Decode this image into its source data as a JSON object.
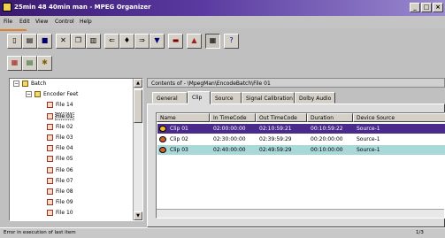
{
  "window": {
    "title": "25min 48 40min man - MPEG Organizer",
    "controls": [
      "_",
      "□",
      "×"
    ]
  },
  "menu": [
    "File",
    "Edit",
    "View",
    "Control",
    "Help"
  ],
  "toolbar_icons": [
    "new-icon",
    "open-icon",
    "save-icon",
    "cut-icon",
    "copy-icon",
    "paste-icon",
    "rewind-icon",
    "play-icon",
    "fast-forward-icon",
    "stop-icon",
    "record-icon",
    "encode-icon",
    "properties-icon",
    "help-icon"
  ],
  "toolbar2_icons": [
    "batch-icon",
    "queue-icon",
    "settings-icon"
  ],
  "tree": {
    "items": [
      {
        "label": "Batch",
        "level": 0,
        "type": "folder",
        "expander": "−"
      },
      {
        "label": "Encoder Feet",
        "level": 1,
        "type": "folder",
        "expander": "−"
      },
      {
        "label": "File 14",
        "level": 2,
        "type": "file"
      },
      {
        "label": "File 01",
        "level": 2,
        "type": "file",
        "selected": true
      },
      {
        "label": "File 02",
        "level": 2,
        "type": "file"
      },
      {
        "label": "File 03",
        "level": 2,
        "type": "file"
      },
      {
        "label": "File 04",
        "level": 2,
        "type": "file"
      },
      {
        "label": "File 05",
        "level": 2,
        "type": "file"
      },
      {
        "label": "File 06",
        "level": 2,
        "type": "file"
      },
      {
        "label": "File 07",
        "level": 2,
        "type": "file"
      },
      {
        "label": "File 08",
        "level": 2,
        "type": "file"
      },
      {
        "label": "File 09",
        "level": 2,
        "type": "file"
      },
      {
        "label": "File 10",
        "level": 2,
        "type": "file"
      }
    ]
  },
  "contents_label": "Contents of - \\MpegMan\\EncodeBatch\\File 01",
  "tabs": [
    {
      "label": "General",
      "active": false
    },
    {
      "label": "Clip",
      "active": true
    },
    {
      "label": "Source",
      "active": false
    },
    {
      "label": "Signal Calibration",
      "active": false
    },
    {
      "label": "Dolby Audio",
      "active": false
    }
  ],
  "table": {
    "columns": [
      "Name",
      "In TimeCode",
      "Out TimeCode",
      "Duration",
      "Device Source"
    ],
    "rows": [
      {
        "cells": [
          "Clip 01",
          "02:00:00:00",
          "02:10:59:21",
          "00:10:59:22",
          "Source-1"
        ],
        "highlight": "#4a2a8a",
        "color": "#ffffff",
        "icon_color": "#f0c020"
      },
      {
        "cells": [
          "Clip 02",
          "02:30:00:00",
          "02:39:59:29",
          "00:20:00:00",
          "Source-1"
        ],
        "highlight": "",
        "color": "#000000",
        "icon_color": "#d06030"
      },
      {
        "cells": [
          "Clip 03",
          "02:40:00:00",
          "02:49:59:29",
          "00:10:00:00",
          "Source-1"
        ],
        "highlight": "#a8d8d8",
        "color": "#000000",
        "icon_color": "#d06030"
      }
    ]
  },
  "status": {
    "message": "Error in execution of last item",
    "page": "1/3"
  }
}
